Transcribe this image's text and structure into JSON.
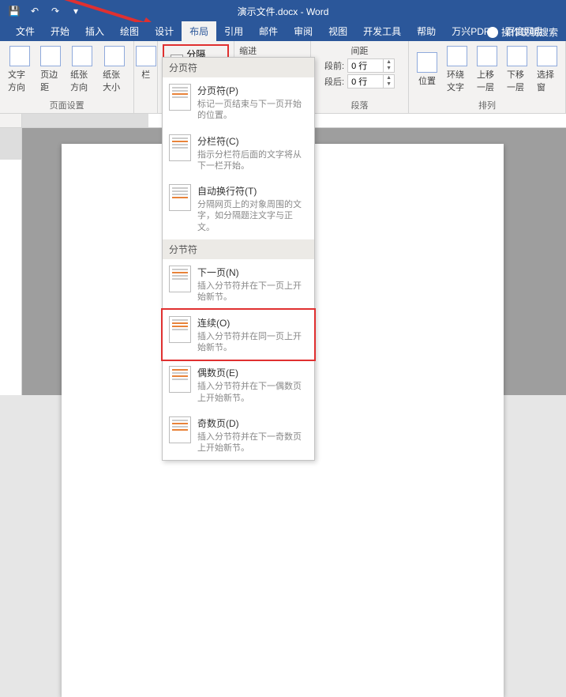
{
  "title": "演示文件.docx - Word",
  "qat": {
    "save": "💾",
    "undo": "↶",
    "redo": "↷",
    "more": "▾"
  },
  "tabs": [
    "文件",
    "开始",
    "插入",
    "绘图",
    "设计",
    "布局",
    "引用",
    "邮件",
    "审阅",
    "视图",
    "开发工具",
    "帮助",
    "万兴PDF",
    "百度网盘"
  ],
  "active_tab": 5,
  "tell_me": "操作说明搜索",
  "ribbon": {
    "page_setup": {
      "text_dir": "文字方向",
      "margins": "页边距",
      "orientation": "纸张方向",
      "size": "纸张大小",
      "columns": "栏",
      "group": "页面设置"
    },
    "breaks": "分隔符",
    "indent_label": "缩进",
    "spacing_label": "间距",
    "spacing_before_lbl": "段前:",
    "spacing_after_lbl": "段后:",
    "spacing_before": "0 行",
    "spacing_after": "0 行",
    "para_group": "段落",
    "arrange": {
      "position": "位置",
      "wrap": "环绕文字",
      "forward": "上移一层",
      "backward": "下移一层",
      "select": "选择窗",
      "group": "排列"
    }
  },
  "dropdown": {
    "section1": "分页符",
    "items1": [
      {
        "t": "分页符(P)",
        "d": "标记一页结束与下一页开始的位置。"
      },
      {
        "t": "分栏符(C)",
        "d": "指示分栏符后面的文字将从下一栏开始。"
      },
      {
        "t": "自动换行符(T)",
        "d": "分隔网页上的对象周围的文字，如分隔题注文字与正文。"
      }
    ],
    "section2": "分节符",
    "items2": [
      {
        "t": "下一页(N)",
        "d": "插入分节符并在下一页上开始新节。"
      },
      {
        "t": "连续(O)",
        "d": "插入分节符并在同一页上开始新节。"
      },
      {
        "t": "偶数页(E)",
        "d": "插入分节符并在下一偶数页上开始新节。"
      },
      {
        "t": "奇数页(D)",
        "d": "插入分节符并在下一奇数页上开始新节。"
      }
    ]
  }
}
